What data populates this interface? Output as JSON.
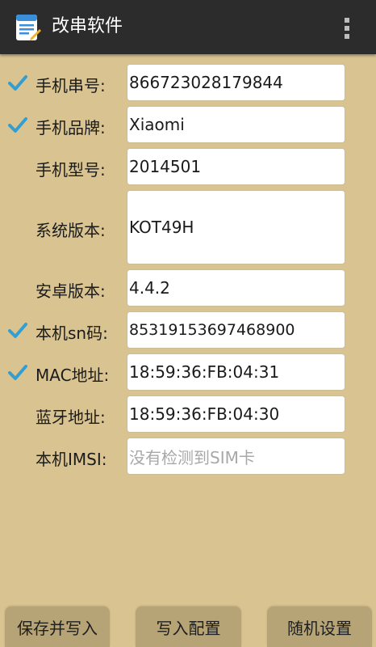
{
  "app": {
    "title": "改串软件"
  },
  "fields": [
    {
      "label": "手机串号:",
      "value": "866723028179844",
      "checked": true
    },
    {
      "label": "手机品牌:",
      "value": "Xiaomi",
      "checked": true
    },
    {
      "label": "手机型号:",
      "value": "2014501",
      "checked": false
    },
    {
      "label": "系统版本:",
      "value": "KOT49H",
      "checked": false
    },
    {
      "label": "安卓版本:",
      "value": "4.4.2",
      "checked": false
    },
    {
      "label": "本机sn码:",
      "value": "85319153697468900",
      "checked": true
    },
    {
      "label": "MAC地址:",
      "value": "18:59:36:FB:04:31",
      "checked": true
    },
    {
      "label": "蓝牙地址:",
      "value": "18:59:36:FB:04:30",
      "checked": false
    },
    {
      "label": "本机IMSI:",
      "placeholder": "没有检测到SIM卡",
      "checked": false
    }
  ],
  "buttons": {
    "save_write": "保存并写入",
    "write_config": "写入配置",
    "random_settings": "随机设置"
  },
  "colors": {
    "background": "#d9c491",
    "action_bar": "#2c2c2c",
    "checkbox": "#2f9fd6",
    "button": "#b7a476"
  },
  "icons": {
    "app": "app-document-icon",
    "menu": "overflow-menu-icon",
    "check": "checkbox-checked-icon"
  }
}
